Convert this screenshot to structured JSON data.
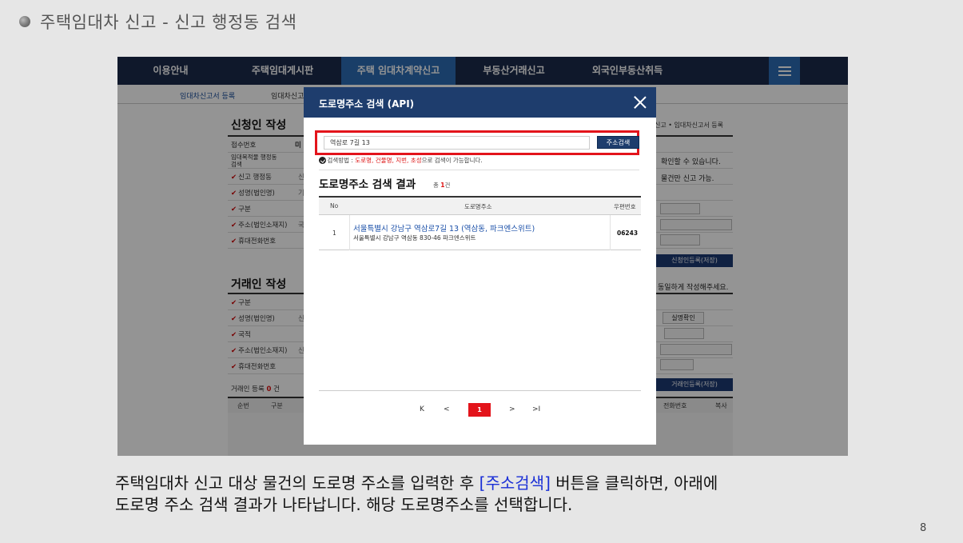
{
  "slide": {
    "title": "주택임대차 신고 - 신고 행정동 검색",
    "caption_line1_a": "주택임대차 신고 대상 물건의 도로명 주소를 입력한 후 ",
    "caption_line1_b": "[주소검색]",
    "caption_line1_c": " 버튼을 클릭하면, 아래에",
    "caption_line2": "도로명 주소 검색 결과가 나타납니다. 해당 도로명주소를 선택합니다.",
    "page_number": "8"
  },
  "nav": {
    "items": [
      "이용안내",
      "주택임대게시판",
      "주택 임대차계약신고",
      "부동산거래신고",
      "외국인부동산취득"
    ],
    "active_index": 2
  },
  "subnav": {
    "item1": "임대차신고서 등록",
    "item2": "임대차신고"
  },
  "form": {
    "applicant_title": "신청인 작성",
    "breadcrumb_right": "신고 • 임대차신고서 등록",
    "row_labels": [
      "접수번호",
      "임대목적물 행정동 검색",
      "신고 행정동",
      "성명(법인명)",
      "구분",
      "주소(법인소재지)",
      "휴대전화번호"
    ],
    "row_values": [
      "미",
      "",
      "신",
      "기",
      "",
      "국",
      ""
    ],
    "note1": "확인할 수 있습니다.",
    "note2": "물건만 신고 가능.",
    "applicant_save": "신청인등록(저장)",
    "tenant_title": "거래인 작성",
    "tenant_note": "동일하게 작성해주세요.",
    "tenant_labels": [
      "구분",
      "성명(법인명)",
      "국적",
      "주소(법인소재지)",
      "휴대전화번호"
    ],
    "tenant_values": [
      "",
      "신",
      "",
      "신",
      ""
    ],
    "verify_button": "실명확인",
    "tenant_save": "거래인등록(저장)",
    "tenant_count_prefix": "거래인 등록 ",
    "tenant_count": "0",
    "tenant_count_suffix": " 건",
    "list_cols": [
      "순번",
      "구분",
      "전화번호",
      "복사"
    ]
  },
  "modal": {
    "title": "도로명주소 검색 (API)",
    "search_value": "역삼로 7길 13",
    "search_button": "주소검색",
    "hint_prefix": "검색방법 : ",
    "hint_red": "도로명, 건물명, 지번, 초성",
    "hint_suffix": "으로 검색이 가능합니다.",
    "result_title": "도로명주소 검색 결과",
    "result_count_prefix": "총 ",
    "result_count": "1",
    "result_count_suffix": "건",
    "columns": [
      "No",
      "도로명주소",
      "우편번호"
    ],
    "rows": [
      {
        "no": "1",
        "road": "서울특별시 강남구 역삼로7길 13 (역삼동, 파크엔스위트)",
        "jibun": "서울특별시 강남구 역삼동 830-46 파크엔스위트",
        "zip": "06243"
      }
    ],
    "pager": {
      "first": "K",
      "prev": "<",
      "current": "1",
      "next": ">",
      "last": ">I"
    }
  },
  "colors": {
    "nav_bg": "#1b2a4a",
    "nav_active": "#2b6cb4",
    "modal_header": "#1e3d6d",
    "highlight_red": "#e3141b",
    "link_blue": "#1a4fa8",
    "caption_blue": "#1a2fd6"
  }
}
